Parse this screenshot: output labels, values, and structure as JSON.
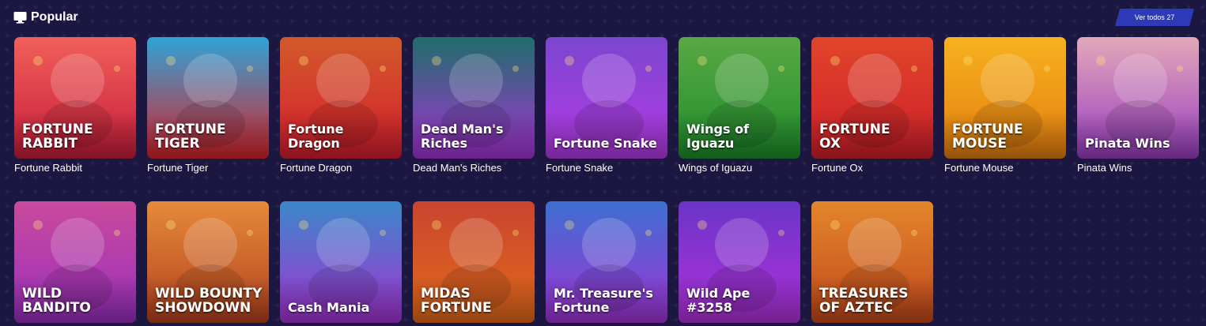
{
  "section": {
    "title": "Popular",
    "icon": "monitor-icon",
    "view_all_label": "Ver todos 27"
  },
  "games": [
    {
      "name": "Fortune Rabbit",
      "logo": "FORTUNE\nRABBIT",
      "upper": true,
      "colors": [
        "#f1605a",
        "#c71c3a"
      ]
    },
    {
      "name": "Fortune Tiger",
      "logo": "FORTUNE\nTIGER",
      "upper": true,
      "colors": [
        "#2fa3d8",
        "#d8242c"
      ]
    },
    {
      "name": "Fortune Dragon",
      "logo": "Fortune Dragon",
      "upper": false,
      "colors": [
        "#d25a2a",
        "#d41d2e"
      ]
    },
    {
      "name": "Dead Man's Riches",
      "logo": "Dead Man's\nRiches",
      "upper": false,
      "colors": [
        "#1f6d6a",
        "#a634d6"
      ]
    },
    {
      "name": "Fortune Snake",
      "logo": "Fortune Snake",
      "upper": false,
      "colors": [
        "#7b46cf",
        "#b53ae6"
      ]
    },
    {
      "name": "Wings of Iguazu",
      "logo": "Wings of\nIguazu",
      "upper": false,
      "colors": [
        "#5aa845",
        "#1f8d2b"
      ]
    },
    {
      "name": "Fortune Ox",
      "logo": "FORTUNE\nOX",
      "upper": true,
      "colors": [
        "#e0452a",
        "#cf1f2a"
      ]
    },
    {
      "name": "Fortune Mouse",
      "logo": "FORTUNE\nMOUSE",
      "upper": true,
      "colors": [
        "#f6b21e",
        "#e57d10"
      ]
    },
    {
      "name": "Pinata Wins",
      "logo": "Pinata Wins",
      "upper": false,
      "colors": [
        "#e3a8b9",
        "#9a3ec2"
      ]
    },
    {
      "name": "Wild Bandito",
      "logo": "WILD\nBANDITO",
      "upper": true,
      "colors": [
        "#c94a9c",
        "#9a2fbf"
      ]
    },
    {
      "name": "Wild Bounty",
      "logo": "WILD BOUNTY\nSHOWDOWN",
      "upper": true,
      "colors": [
        "#e58a3a",
        "#b4411e"
      ]
    },
    {
      "name": "Cash Mania",
      "logo": "Cash Mania",
      "upper": false,
      "colors": [
        "#3b88c9",
        "#a533d4"
      ]
    },
    {
      "name": "Midas Fortune",
      "logo": "MIDAS\nFORTUNE",
      "upper": true,
      "colors": [
        "#c8452f",
        "#e36a1b"
      ]
    },
    {
      "name": "Mr. Treasure's Fortune",
      "logo": "Mr. Treasure's\nFortune",
      "upper": false,
      "colors": [
        "#3d6fd0",
        "#a234d8"
      ]
    },
    {
      "name": "Wild Ape #3258",
      "logo": "Wild Ape #3258",
      "upper": false,
      "colors": [
        "#6b34c7",
        "#b032db"
      ]
    },
    {
      "name": "Treasures of Aztec",
      "logo": "TREASURES\nOF AZTEC",
      "upper": true,
      "colors": [
        "#e3862c",
        "#c2481c"
      ]
    }
  ]
}
